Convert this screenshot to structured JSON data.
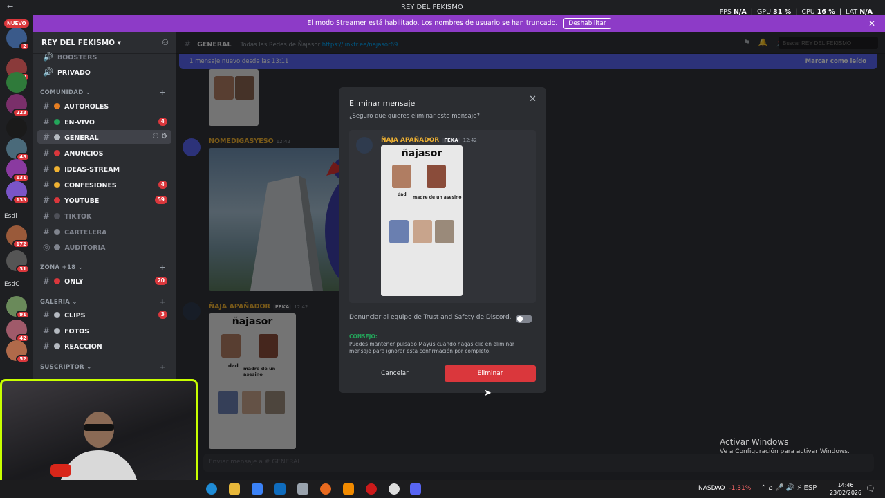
{
  "window": {
    "title": "REY DEL FEKISMO"
  },
  "stats": {
    "fps_label": "FPS",
    "fps": "N/A",
    "gpu_label": "GPU",
    "gpu": "31 %",
    "cpu_label": "CPU",
    "cpu": "16 %",
    "lat_label": "LAT",
    "lat": "N/A"
  },
  "rail": {
    "new_badge": "NUEVO",
    "servers": [
      {
        "badge": "2"
      },
      {
        "badge": "9"
      },
      {
        "badge": ""
      },
      {
        "badge": "223"
      },
      {
        "badge": ""
      },
      {
        "badge": "48"
      },
      {
        "badge": "131"
      },
      {
        "badge": "133"
      },
      {
        "text": "Esdi"
      },
      {
        "badge": "172"
      },
      {
        "badge": "31"
      },
      {
        "text": "EsdC"
      },
      {
        "badge": "91"
      },
      {
        "badge": "42"
      },
      {
        "badge": "52"
      }
    ]
  },
  "banner": {
    "text": "El modo Streamer está habilitado. Los nombres de usuario se han truncado.",
    "button": "Deshabilitar"
  },
  "sidebar": {
    "server_name": "REY DEL FEKISMO",
    "channels_top": [
      {
        "name": "BOOSTERS",
        "muted": true
      },
      {
        "name": "PRIVADO",
        "muted": false
      }
    ],
    "categories": [
      {
        "name": "COMUNIDAD"
      },
      {
        "name": "ZONA +18"
      },
      {
        "name": "GALERIA"
      },
      {
        "name": "SUSCRIPTOR"
      }
    ],
    "comunidad": [
      {
        "name": "AUTOROLES",
        "count": "",
        "color": "#e67e22"
      },
      {
        "name": "EN-VIVO",
        "count": "4",
        "color": "#23a55a"
      },
      {
        "name": "GENERAL",
        "count": "",
        "color": "#b5bac1"
      },
      {
        "name": "ANUNCIOS",
        "count": "",
        "color": "#da373c"
      },
      {
        "name": "IDEAS-STREAM",
        "count": "",
        "color": "#f0b232"
      },
      {
        "name": "CONFESIONES",
        "count": "4",
        "color": "#f0b232"
      },
      {
        "name": "YOUTUBE",
        "count": "59",
        "color": "#da373c"
      },
      {
        "name": "TIKTOK",
        "count": "",
        "color": "#4e5058"
      },
      {
        "name": "CARTELERA",
        "count": "",
        "color": "#80848e"
      },
      {
        "name": "AUDITORIA",
        "count": "",
        "color": "#80848e"
      }
    ],
    "zona": [
      {
        "name": "ONLY",
        "count": "20",
        "color": "#da373c"
      }
    ],
    "galeria": [
      {
        "name": "CLIPS",
        "count": "3",
        "color": "#b5bac1"
      },
      {
        "name": "FOTOS",
        "count": "",
        "color": "#b5bac1"
      },
      {
        "name": "REACCION",
        "count": "",
        "color": "#b5bac1"
      }
    ]
  },
  "channel_header": {
    "name": "GENERAL",
    "topic": "Todas las Redes de Ñajasor",
    "link": "https://linktr.ee/najasor69",
    "search_placeholder": "Buscar REY DEL FEKISMO"
  },
  "new_messages": {
    "text": "1 mensaje nuevo desde las 13:11",
    "mark": "Marcar como leído"
  },
  "messages": [
    {
      "author": "NOMEDIGASYESO",
      "time": "12:42",
      "author_color": "#f0b232"
    },
    {
      "author": "ÑAJA APAÑADOR",
      "tag": "FEKA",
      "time": "12:42",
      "author_color": "#f0b232"
    }
  ],
  "id_card": {
    "title": "ñajasor",
    "cap_dad": "dad",
    "cap_mom": "madre de un asesino"
  },
  "composer": {
    "placeholder": "Enviar mensaje a #",
    "channel": "GENERAL"
  },
  "modal": {
    "title": "Eliminar mensaje",
    "subtitle": "¿Seguro que quieres eliminar este mensaje?",
    "preview_author": "ÑAJA APAÑADOR",
    "preview_tag": "FEKA",
    "preview_time": "12:42",
    "report": "Denunciar al equipo de Trust and Safety de Discord.",
    "tip_label": "CONSEJO:",
    "tip": "Puedes mantener pulsado Mayús cuando hagas clic en eliminar mensaje para ignorar esta confirmación por completo.",
    "cancel": "Cancelar",
    "delete": "Eliminar"
  },
  "watermark": {
    "title": "Activar Windows",
    "sub": "Ve a Configuración para activar Windows."
  },
  "taskbar": {
    "ticker": "NASDAQ",
    "change": "-1.31%",
    "lang": "ESP",
    "time": "14:46",
    "date": "23/02/2026"
  }
}
